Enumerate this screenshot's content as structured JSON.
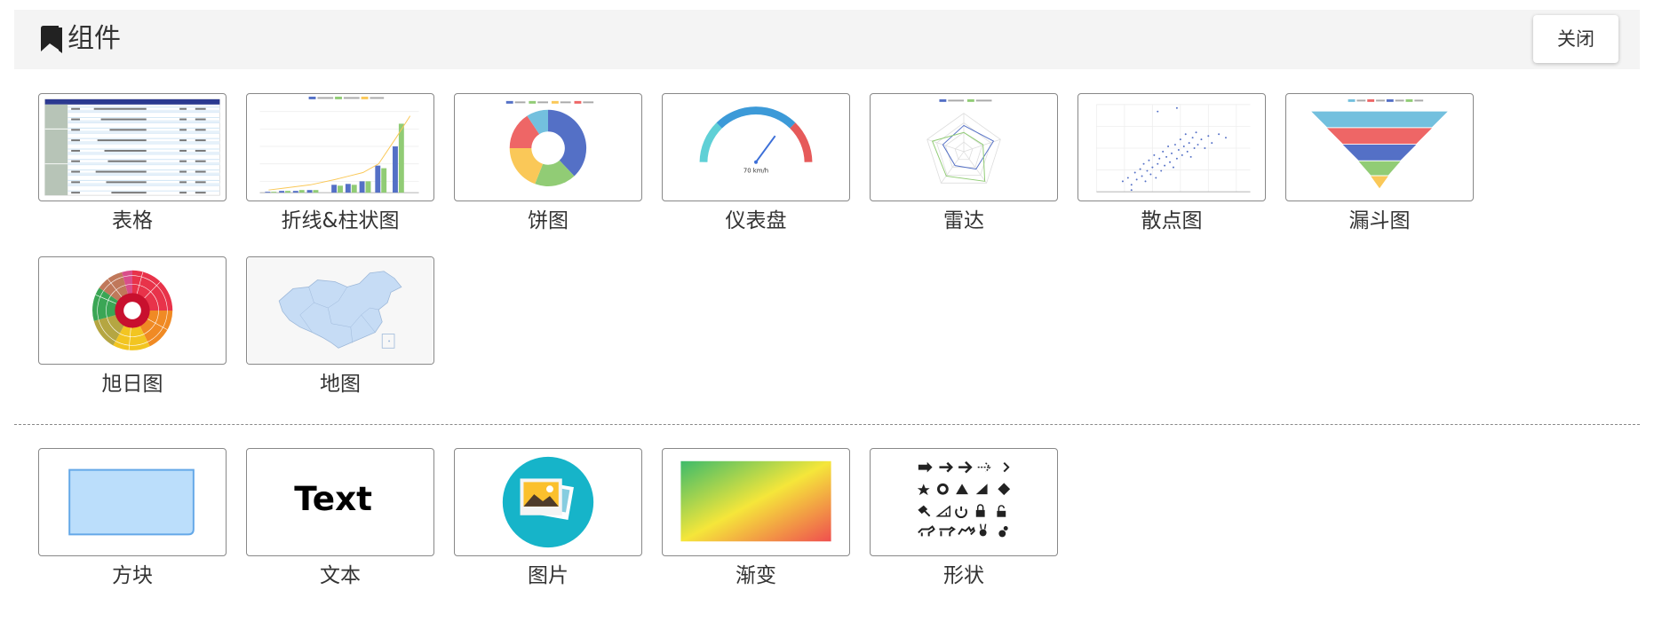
{
  "header": {
    "title": "组件",
    "close_label": "关闭",
    "icon": "bookmark-icon"
  },
  "charts_section": {
    "items": [
      {
        "label": "表格",
        "icon": "table-thumbnail"
      },
      {
        "label": "折线&柱状图",
        "icon": "line-bar-chart-thumbnail"
      },
      {
        "label": "饼图",
        "icon": "pie-chart-thumbnail"
      },
      {
        "label": "仪表盘",
        "icon": "gauge-thumbnail",
        "gauge_text": "70 km/h"
      },
      {
        "label": "雷达",
        "icon": "radar-chart-thumbnail"
      },
      {
        "label": "散点图",
        "icon": "scatter-chart-thumbnail"
      },
      {
        "label": "漏斗图",
        "icon": "funnel-chart-thumbnail"
      },
      {
        "label": "旭日图",
        "icon": "sunburst-chart-thumbnail"
      },
      {
        "label": "地图",
        "icon": "map-thumbnail"
      }
    ]
  },
  "basic_section": {
    "items": [
      {
        "label": "方块",
        "icon": "rectangle-thumbnail"
      },
      {
        "label": "文本",
        "icon": "text-thumbnail",
        "preview_text": "Text"
      },
      {
        "label": "图片",
        "icon": "image-thumbnail"
      },
      {
        "label": "渐变",
        "icon": "gradient-thumbnail"
      },
      {
        "label": "形状",
        "icon": "shapes-thumbnail"
      }
    ]
  },
  "colors": {
    "header_bg": "#f4f4f4",
    "tile_border": "#888888",
    "rect_fill": "#bbdefb",
    "rect_stroke": "#64a8e8",
    "image_circle": "#16b4c9"
  }
}
